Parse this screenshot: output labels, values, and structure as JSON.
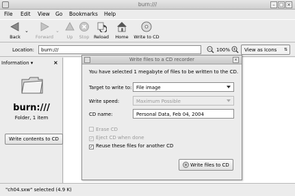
{
  "window": {
    "title": "burn:///"
  },
  "menu": [
    "File",
    "Edit",
    "View",
    "Go",
    "Bookmarks",
    "Help"
  ],
  "toolbar": {
    "back": "Back",
    "forward": "Forward",
    "up": "Up",
    "stop": "Stop",
    "reload": "Reload",
    "home": "Home",
    "write": "Write to CD"
  },
  "location": {
    "label": "Location:",
    "value": "burn:///",
    "zoom": "100%",
    "view": "View as Icons"
  },
  "sidebar": {
    "header": "Information",
    "title": "burn:///",
    "subtitle": "Folder, 1 item",
    "button": "Write contents to CD"
  },
  "status": "\"ch04.sxw\" selected (4.9 K)",
  "dialog": {
    "title": "Write files to a CD recorder",
    "message": "You have selected 1 megabyte of files to be written to the CD.",
    "target_label": "Target to write to:",
    "target_value": "File image",
    "speed_label": "Write speed:",
    "speed_value": "Maximum Possible",
    "name_label": "CD name:",
    "name_value": "Personal Data, Feb 04, 2004",
    "erase": "Erase CD",
    "eject": "Eject CD when done",
    "reuse": "Reuse these files for another CD",
    "write_button": "Write files to CD"
  }
}
